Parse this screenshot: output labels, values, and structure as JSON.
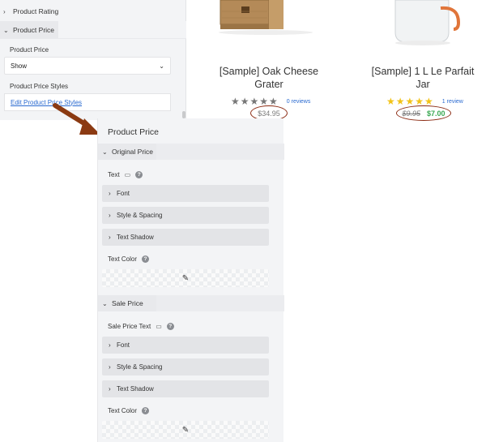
{
  "top_panel": {
    "product_rating_label": "Product Rating",
    "product_price_label": "Product Price",
    "price_field_label": "Product Price",
    "price_select_value": "Show",
    "price_styles_label": "Product Price Styles",
    "price_styles_link": "Edit Product Price Styles"
  },
  "products": [
    {
      "title_line1": "[Sample] Oak Cheese",
      "title_line2": "Grater",
      "stars": "★★★★★",
      "star_color": "#777777",
      "reviews": "0 reviews",
      "price": "$34.95",
      "price_color": "#7a7a7a"
    },
    {
      "title_line1": "[Sample] 1 L Le Parfait",
      "title_line2": "Jar",
      "stars": "★★★★★",
      "star_color": "#f2c318",
      "reviews": "1 review",
      "old_price": "$9.95",
      "sale_price": "$7.00",
      "old_price_color": "#7a7a7a",
      "sale_price_color": "#3aa853"
    }
  ],
  "styles_panel": {
    "title": "Product Price",
    "original_price": {
      "heading": "Original Price",
      "text_label": "Text",
      "font": "Font",
      "style_spacing": "Style & Spacing",
      "text_shadow": "Text Shadow",
      "text_color": "Text Color"
    },
    "sale_price": {
      "heading": "Sale Price",
      "text_label": "Sale Price Text",
      "font": "Font",
      "style_spacing": "Style & Spacing",
      "text_shadow": "Text Shadow",
      "text_color": "Text Color"
    }
  },
  "icons": {
    "chevron_right": "›",
    "chevron_down": "⌄",
    "help": "?",
    "desktop": "🖥",
    "eyedropper": "✎"
  },
  "colors": {
    "annotation_arrow": "#8b3a12",
    "annotation_oval": "#8b2a12",
    "link": "#2a6ad0"
  }
}
